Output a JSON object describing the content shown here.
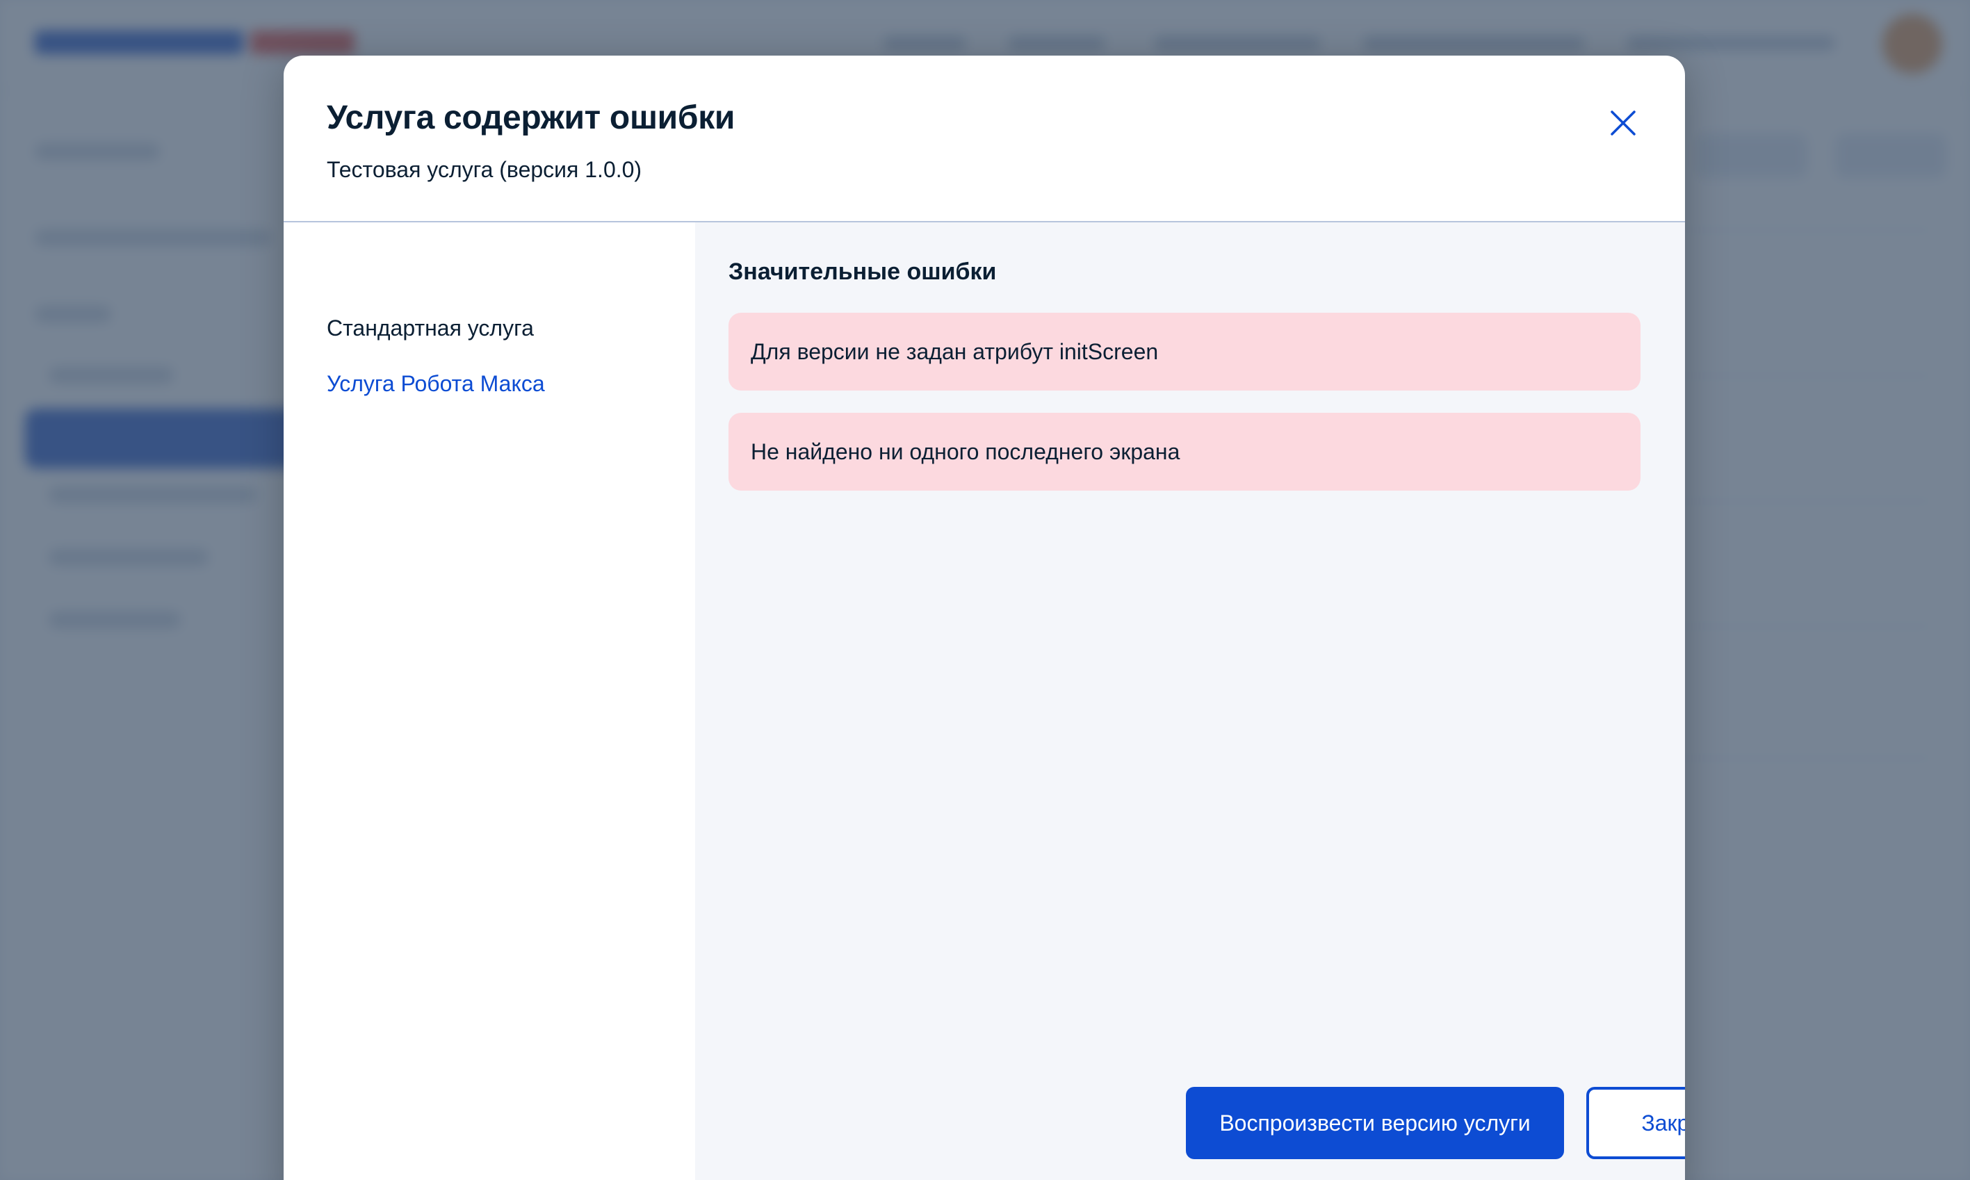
{
  "modal": {
    "title": "Услуга содержит ошибки",
    "subtitle": "Тестовая услуга (версия 1.0.0)"
  },
  "sidebar": {
    "items": [
      {
        "label": "Стандартная услуга",
        "active": false
      },
      {
        "label": "Услуга Робота Макса",
        "active": true
      }
    ]
  },
  "main": {
    "section_title": "Значительные ошибки",
    "errors": [
      "Для версии не задан атрибут initScreen",
      "Не найдено ни одного последнего экрана"
    ]
  },
  "actions": {
    "play_label": "Воспроизвести версию услуги",
    "close_label": "Закрыть"
  },
  "icons": {
    "close": "close-icon"
  },
  "colors": {
    "accent": "#0d4cd3",
    "error_bg": "#fcd9df",
    "text": "#0b1f33",
    "panel_bg": "#f4f6fa",
    "overlay": "#42546b"
  }
}
